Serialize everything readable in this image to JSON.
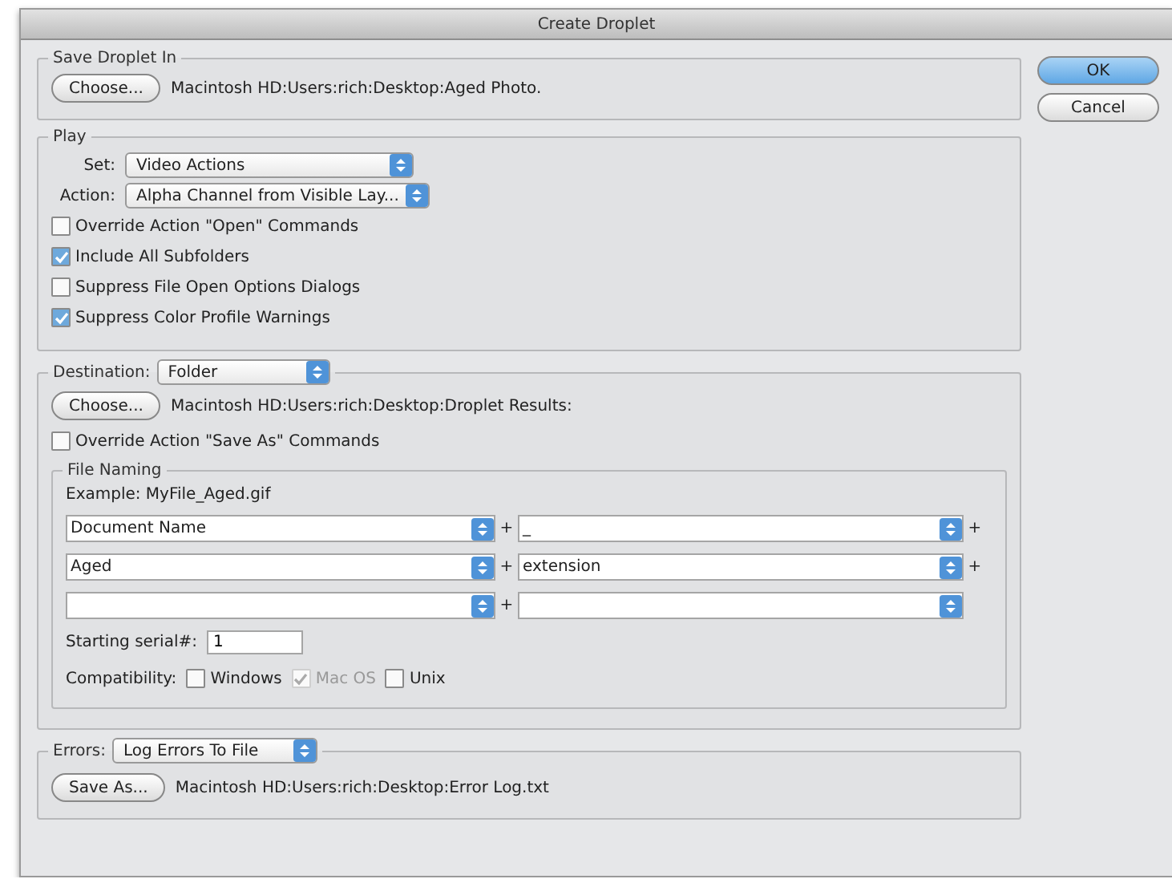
{
  "window": {
    "title": "Create Droplet"
  },
  "save_droplet_in": {
    "title": "Save Droplet In",
    "button": "Choose...",
    "path": "Macintosh HD:Users:rich:Desktop:Aged Photo."
  },
  "play": {
    "title": "Play",
    "set": {
      "label": "Set:",
      "value": "Video Actions"
    },
    "action": {
      "label": "Action:",
      "value": "Alpha Channel from Visible Lay..."
    },
    "options": [
      {
        "label": "Override Action \"Open\" Commands",
        "checked": false
      },
      {
        "label": "Include All Subfolders",
        "checked": true
      },
      {
        "label": "Suppress File Open Options Dialogs",
        "checked": false
      },
      {
        "label": "Suppress Color Profile Warnings",
        "checked": true
      }
    ]
  },
  "destination": {
    "label": "Destination:",
    "value": "Folder",
    "button": "Choose...",
    "path": "Macintosh HD:Users:rich:Desktop:Droplet Results:",
    "override": {
      "label": "Override Action \"Save As\" Commands",
      "checked": false
    },
    "file_naming": {
      "title": "File Naming",
      "example": "Example: MyFile_Aged.gif",
      "rows": [
        {
          "left": "Document Name",
          "join": "+",
          "right": "_",
          "trailing": "+"
        },
        {
          "left": "Aged",
          "join": "+",
          "right": "extension",
          "trailing": "+"
        },
        {
          "left": "",
          "join": "+",
          "right": ""
        }
      ],
      "serial": {
        "label": "Starting serial#:",
        "value": "1"
      },
      "compatibility": {
        "label": "Compatibility:",
        "options": [
          {
            "label": "Windows",
            "checked": false,
            "disabled": false
          },
          {
            "label": "Mac OS",
            "checked": true,
            "disabled": true
          },
          {
            "label": "Unix",
            "checked": false,
            "disabled": false
          }
        ]
      }
    }
  },
  "errors": {
    "label": "Errors:",
    "value": "Log Errors To File",
    "button": "Save As...",
    "path": "Macintosh HD:Users:rich:Desktop:Error Log.txt"
  },
  "buttons": [
    {
      "label": "OK",
      "default": true
    },
    {
      "label": "Cancel",
      "default": false
    }
  ]
}
